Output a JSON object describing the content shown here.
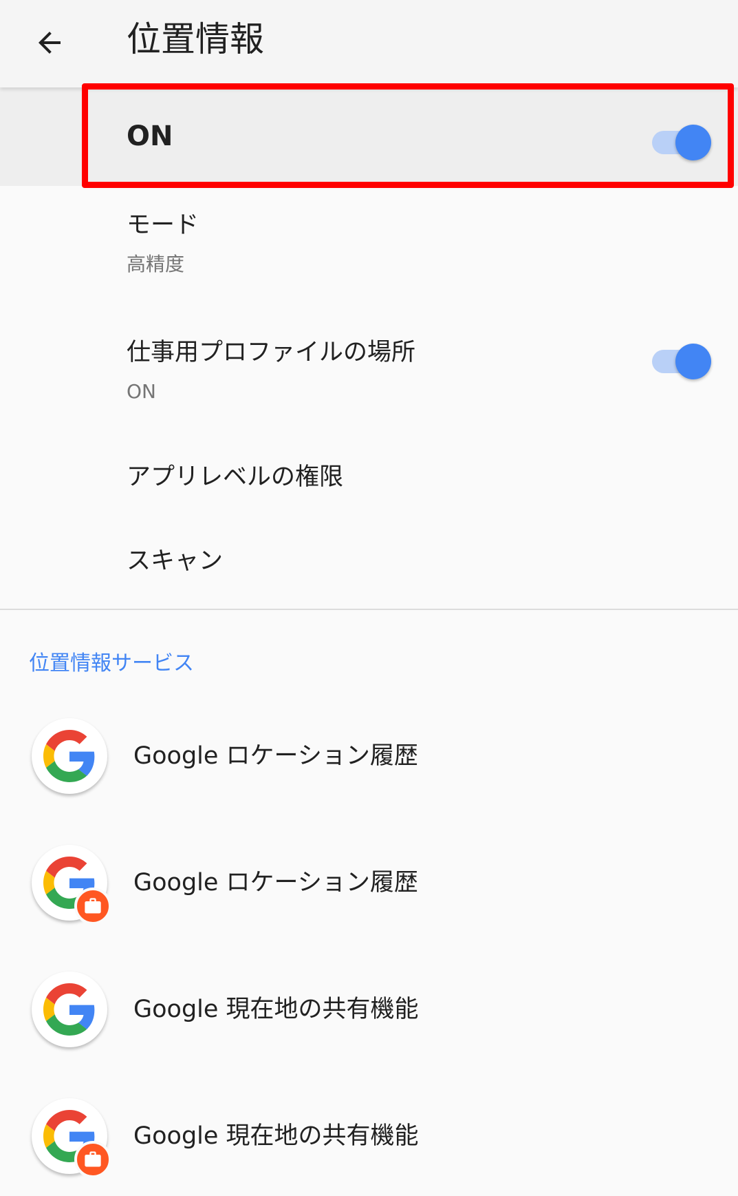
{
  "app_bar": {
    "title": "位置情報"
  },
  "master_switch": {
    "label": "ON",
    "state": true
  },
  "settings": [
    {
      "title": "モード",
      "subtitle": "高精度"
    },
    {
      "title": "仕事用プロファイルの場所",
      "subtitle": "ON",
      "switch_state": true
    },
    {
      "title": "アプリレベルの権限"
    },
    {
      "title": "スキャン"
    }
  ],
  "services_section": {
    "header": "位置情報サービス",
    "items": [
      {
        "label": "Google ロケーション履歴",
        "icon": "google-icon",
        "work_badge": false
      },
      {
        "label": "Google ロケーション履歴",
        "icon": "google-icon",
        "work_badge": true
      },
      {
        "label": "Google 現在地の共有機能",
        "icon": "google-icon",
        "work_badge": false
      },
      {
        "label": "Google 現在地の共有機能",
        "icon": "google-icon",
        "work_badge": true
      }
    ]
  },
  "colors": {
    "accent": "#4285f4",
    "highlight": "#ff0000",
    "work_badge": "#ff5722"
  }
}
